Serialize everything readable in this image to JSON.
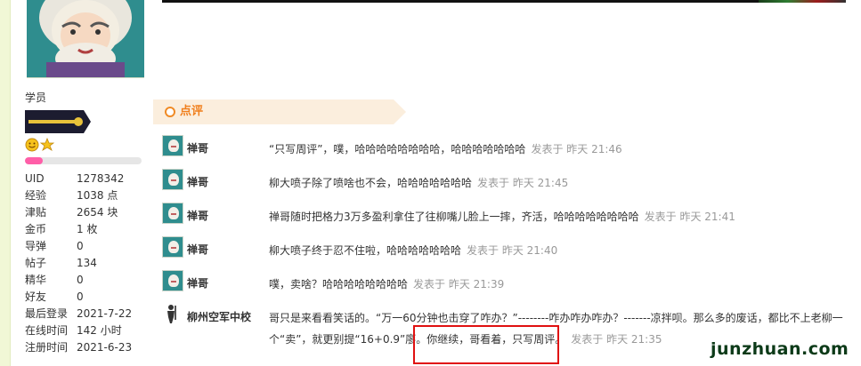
{
  "profile": {
    "user_group": "学员",
    "stats": [
      {
        "label": "UID",
        "value": "1278342"
      },
      {
        "label": "经验",
        "value": "1038 点"
      },
      {
        "label": "津贴",
        "value": "2654 块"
      },
      {
        "label": "金币",
        "value": "1 枚"
      },
      {
        "label": "导弹",
        "value": "0"
      },
      {
        "label": "帖子",
        "value": "134"
      },
      {
        "label": "精华",
        "value": "0"
      },
      {
        "label": "好友",
        "value": "0"
      },
      {
        "label": "最后登录",
        "value": "2021-7-22"
      },
      {
        "label": "在线时间",
        "value": "142 小时"
      },
      {
        "label": "注册时间",
        "value": "2021-6-23"
      }
    ],
    "level_progress": 0.15
  },
  "comments_section": {
    "title": "点评",
    "items": [
      {
        "author": "禅哥",
        "text": "“只写周评”，噗，哈哈哈哈哈哈哈哈，哈哈哈哈哈哈哈",
        "time": "发表于 昨天 21:46"
      },
      {
        "author": "禅哥",
        "text": "柳大喷子除了喷啥也不会，哈哈哈哈哈哈哈",
        "time": "发表于 昨天 21:45"
      },
      {
        "author": "禅哥",
        "text": "禅哥随时把格力3万多盈利拿住了往柳嘴儿脸上一摔，齐活，哈哈哈哈哈哈哈哈",
        "time": "发表于 昨天 21:41"
      },
      {
        "author": "禅哥",
        "text": "柳大喷子终于忍不住啦，哈哈哈哈哈哈哈",
        "time": "发表于 昨天 21:40"
      },
      {
        "author": "禅哥",
        "text": "噗，卖啥？哈哈哈哈哈哈哈哈",
        "time": "发表于 昨天 21:39"
      },
      {
        "author": "柳州空军中校",
        "text_line1": "哥只是来看看笑话的。“万一60分钟也击穿了咋办？”--------咋办咋办咋办？-------凉拌呗。那么多的废话，都比不上老柳一",
        "text_line2": "个“卖”，就更别提“16+0.9”廖。你继续，哥看着，只写周评。",
        "time": "发表于 昨天 21:35"
      }
    ]
  },
  "watermark": "junzhuan.com",
  "colors": {
    "accent_orange": "#f07f1c",
    "highlight_red": "#e01010",
    "header_bg": "#fbeedd"
  }
}
